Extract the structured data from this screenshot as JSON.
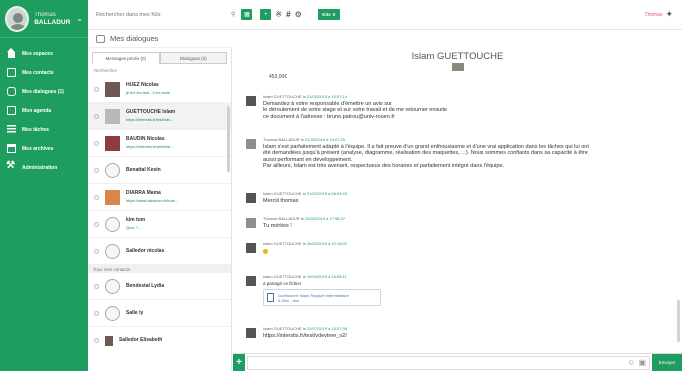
{
  "user": {
    "first_name": "Thomas",
    "last_name": "BALLADUR"
  },
  "sidebar": {
    "items": [
      {
        "label": "Mes espaces",
        "icon": "home-icon"
      },
      {
        "label": "Mes contacts",
        "icon": "contacts-icon"
      },
      {
        "label": "Mes dialogues (1)",
        "icon": "chat-icon"
      },
      {
        "label": "Mon agenda",
        "icon": "agenda-icon"
      },
      {
        "label": "Mes tâches",
        "icon": "tasks-icon"
      },
      {
        "label": "Mes archives",
        "icon": "archive-icon"
      },
      {
        "label": "Administration",
        "icon": "tools-icon"
      }
    ]
  },
  "topbar": {
    "search_placeholder": "Rechercher dans mes Kits",
    "badge_label": "Kits",
    "badge_count": "0",
    "user_label": "Thomas"
  },
  "section_title": "Mes dialogues",
  "list": {
    "tabs": [
      {
        "label": "Messages privés (0)"
      },
      {
        "label": "Dialogues (2)"
      }
    ],
    "filter_label": "Rechercher",
    "conversations": [
      {
        "name": "HUEZ Nicolas",
        "sub": "je fini les test - il en reste"
      },
      {
        "name": "GUETTOUCHE Islam",
        "sub": "https://interstis.fr/test/vdv..."
      },
      {
        "name": "BAUDIN Nicolas",
        "sub": "https://interstis.fr/web/nle..."
      },
      {
        "name": "Benattal Kevin",
        "sub": ""
      },
      {
        "name": "DIARRA Mama",
        "sub": "https://www.labocom.fr/inde..."
      },
      {
        "name": "kim tom",
        "sub": "Quoi ?..."
      },
      {
        "name": "Salledor nicolas",
        "sub": ""
      }
    ],
    "section_all": "Tous mes contacts",
    "contacts": [
      {
        "name": "Bendestal Lydia"
      },
      {
        "name": "Salle ly"
      },
      {
        "name": "Salledor Elisabeth"
      }
    ]
  },
  "chat": {
    "title": "Islam GUETTOUCHE",
    "pre_text": "453,00€",
    "messages": [
      {
        "author": "Islam GUETTOUCHE",
        "meta": "le 21/02/2019 à 10:07:14",
        "lines": [
          "Demandez à votre responsable d'émettre un avis sur",
          "le déroulement de votre stage et sur votre travail et de me retourner ensuite",
          "ce document à l'adresse : bruno.patrou@univ-rouen.fr"
        ]
      },
      {
        "author": "Thomas BALLADUR",
        "meta": "le 21/02/2019 à 10:07:29",
        "lines": [
          "Islam s'est parfaitement adapté à l'équipe. Il a fait preuve d'un grand enthousiasme et d'une vrai application dans les tâches qui lui ont",
          "été demandées jusqu'à présent (analyse, diagramme, réalisation des maquettes, ...). Nous sommes confiants dans sa capacité à être",
          "aussi performant en développement.",
          "Par ailleurs, Islam est très avenant, respectueux des horaires et parfaitement intégré dans l'équipe."
        ]
      },
      {
        "author": "Islam GUETTOUCHE",
        "meta": "le 21/02/2019 à 08:54:53",
        "lines": [
          "Merciii thomas"
        ]
      },
      {
        "author": "Thomas BALLADUR",
        "meta": "le 22/02/2019 à 17:58:47",
        "lines": [
          "Tu mérites !"
        ]
      },
      {
        "author": "Islam GUETTOUCHE",
        "meta": "le 26/02/2019 à 10:15:02",
        "lines": []
      },
      {
        "author": "Islam GUETTOUCHE",
        "meta": "le 19/04/2019 à 15:08:11",
        "lines": [
          "a partagé ce fichier"
        ],
        "file_name": "Guettouche Islam Rapport intermédiaire",
        "file_sub": "0.28m - doc"
      },
      {
        "author": "Islam GUETTOUCHE",
        "meta": "le 22/07/2019 à 15:07:38",
        "lines": [
          "https://interstis.fr/test/vdevtree_v2/"
        ]
      }
    ]
  },
  "composer": {
    "send_label": "Envoyer"
  },
  "colors": {
    "brand": "#1e9e5e",
    "accent_red": "#e0566b"
  }
}
